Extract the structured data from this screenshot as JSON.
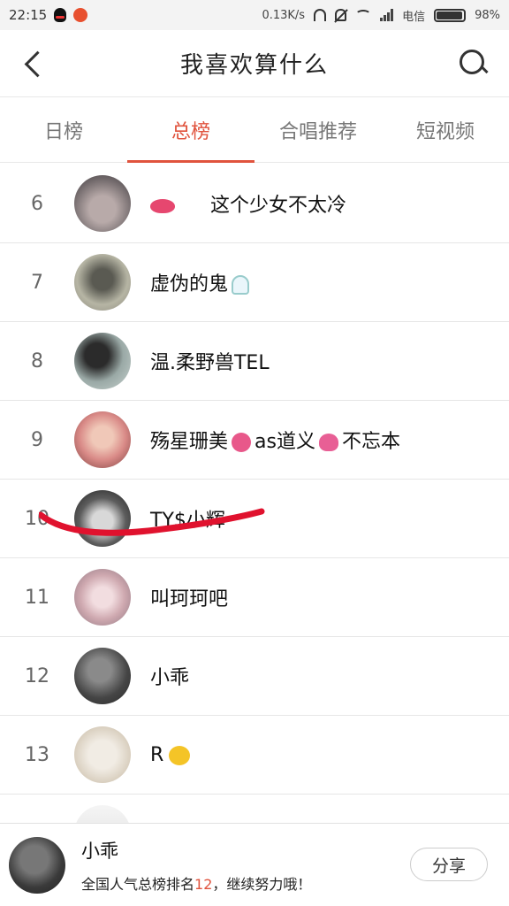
{
  "status_bar": {
    "time": "22:15",
    "network_speed": "0.13K/s",
    "carrier": "电信",
    "battery_text": "98%",
    "battery_level": 0.98,
    "icons": [
      "qq-icon",
      "app-notification-icon",
      "headset-icon",
      "mute-icon",
      "wifi-icon",
      "signal-icon",
      "battery-icon"
    ]
  },
  "header": {
    "title": "我喜欢算什么",
    "back_icon": "chevron-left-icon",
    "search_icon": "search-icon"
  },
  "tabs": [
    {
      "label": "日榜",
      "active": false
    },
    {
      "label": "总榜",
      "active": true
    },
    {
      "label": "合唱推荐",
      "active": false
    },
    {
      "label": "短视频",
      "active": false
    }
  ],
  "accent_color": "#e0533d",
  "ranking": [
    {
      "rank": "6",
      "name": "这个少女不太冷",
      "prefix_icon": "lips-icon"
    },
    {
      "rank": "7",
      "name": "虚伪的鬼",
      "suffix_icon": "ghost-icon"
    },
    {
      "rank": "8",
      "name": "温.柔野兽TEL"
    },
    {
      "rank": "9",
      "name_parts": [
        "殇星珊美",
        "as道义",
        "不忘本"
      ],
      "icons": [
        "flower-icon",
        "heart-icon"
      ]
    },
    {
      "rank": "10",
      "name": "TY$小辉"
    },
    {
      "rank": "11",
      "name": "叫珂珂吧"
    },
    {
      "rank": "12",
      "name": "小乖",
      "highlighted": true
    },
    {
      "rank": "13",
      "name": "R",
      "suffix_icon": "emoji-face-icon"
    }
  ],
  "bottom_bar": {
    "name": "小乖",
    "desc_prefix": "全国人气总榜排名",
    "desc_rank": "12",
    "desc_suffix": "，继续努力哦！",
    "share_label": "分享"
  }
}
